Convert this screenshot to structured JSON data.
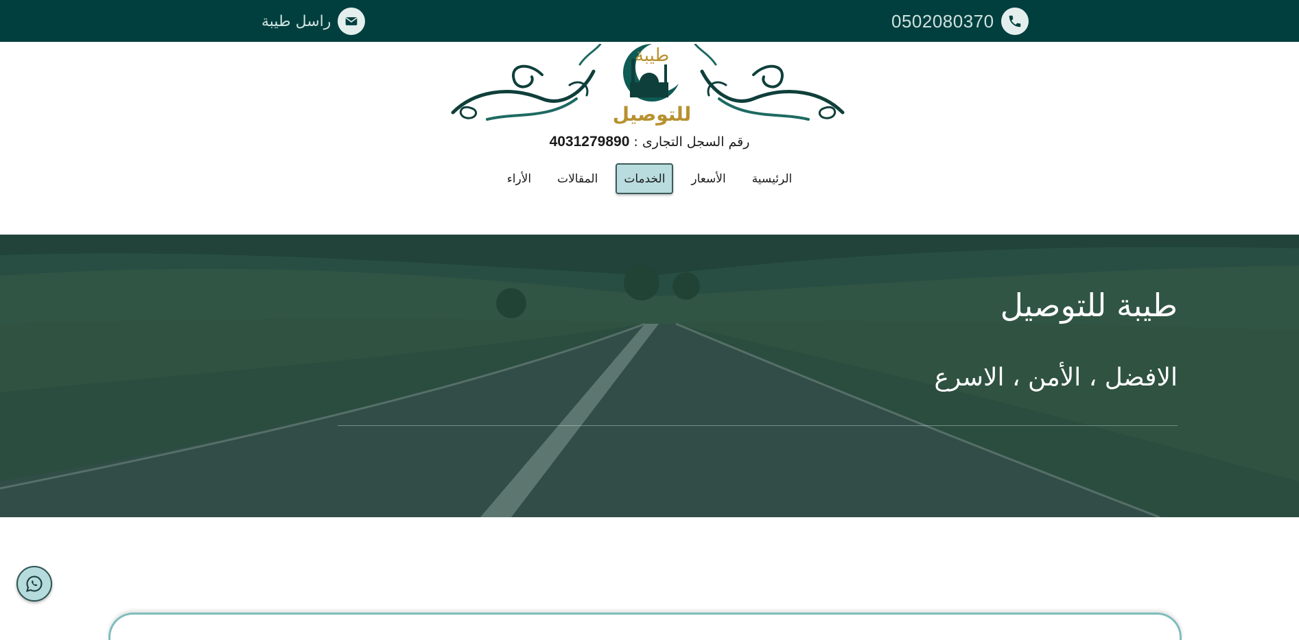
{
  "topbar": {
    "phone_icon": "phone-icon",
    "phone": "0502080370",
    "mail_icon": "envelope-icon",
    "contact_label": "راسل طيبة"
  },
  "header": {
    "logo_text": "للتوصيل",
    "logo_script": "طيبة",
    "registration_label": "رقم السجل التجارى :",
    "registration_number": "4031279890"
  },
  "nav": {
    "items": [
      {
        "label": "الرئيسية",
        "active": false
      },
      {
        "label": "الأسعار",
        "active": false
      },
      {
        "label": "الخدمات",
        "active": true
      },
      {
        "label": "المقالات",
        "active": false
      },
      {
        "label": "الأراء",
        "active": false
      }
    ]
  },
  "hero": {
    "title": "طيبة للتوصيل",
    "subtitle": "الافضل ، الأمن ، الاسرع"
  },
  "floating": {
    "whatsapp_icon": "whatsapp-icon"
  },
  "colors": {
    "topbar_bg": "#013f3e",
    "accent": "#b9dcde",
    "logo_gold": "#b8912f",
    "logo_teal": "#0f5b55"
  }
}
